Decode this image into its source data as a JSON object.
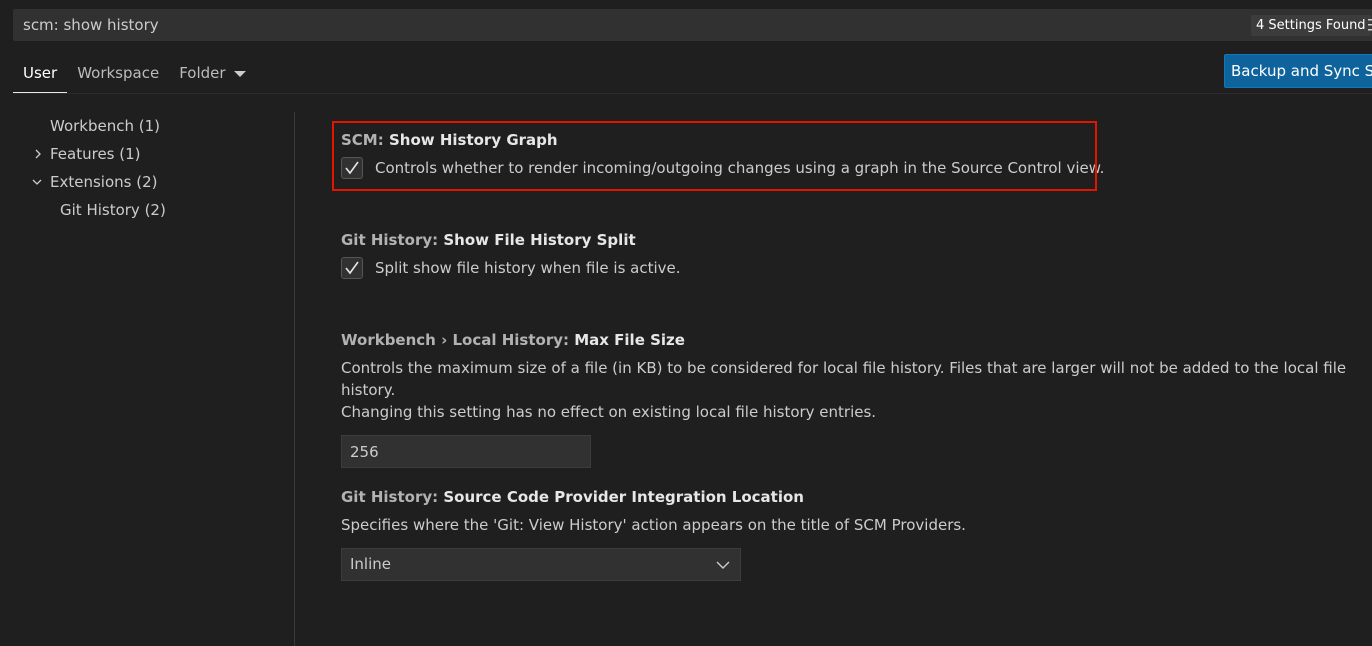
{
  "search": {
    "value": "scm: show history",
    "result_count": "4 Settings Found"
  },
  "tabs": [
    {
      "label": "User"
    },
    {
      "label": "Workspace"
    },
    {
      "label": "Folder"
    }
  ],
  "sync_button_label": "Backup and Sync Settings",
  "toc": [
    {
      "label": "Workbench (1)"
    },
    {
      "label": "Features (1)"
    },
    {
      "label": "Extensions (2)"
    },
    {
      "label": "Git History (2)"
    }
  ],
  "settings": {
    "scm_graph": {
      "category": "SCM: ",
      "key": "Show History Graph",
      "description": "Controls whether to render incoming/outgoing changes using a graph in the Source Control view."
    },
    "git_split": {
      "category": "Git History: ",
      "key": "Show File History Split",
      "description": "Split show file history when file is active."
    },
    "local_history": {
      "category": "Workbench › Local History: ",
      "key": "Max File Size",
      "description_line1": "Controls the maximum size of a file (in KB) to be considered for local file history. Files that are larger will not be added to the local file history.",
      "description_line2": "Changing this setting has no effect on existing local file history entries.",
      "value": "256"
    },
    "git_location": {
      "category": "Git History: ",
      "key": "Source Code Provider Integration Location",
      "description": "Specifies where the 'Git: View History' action appears on the title of SCM Providers.",
      "value": "Inline"
    }
  },
  "colors": {
    "highlight": "#e51400",
    "accent_button": "#0e639c"
  }
}
